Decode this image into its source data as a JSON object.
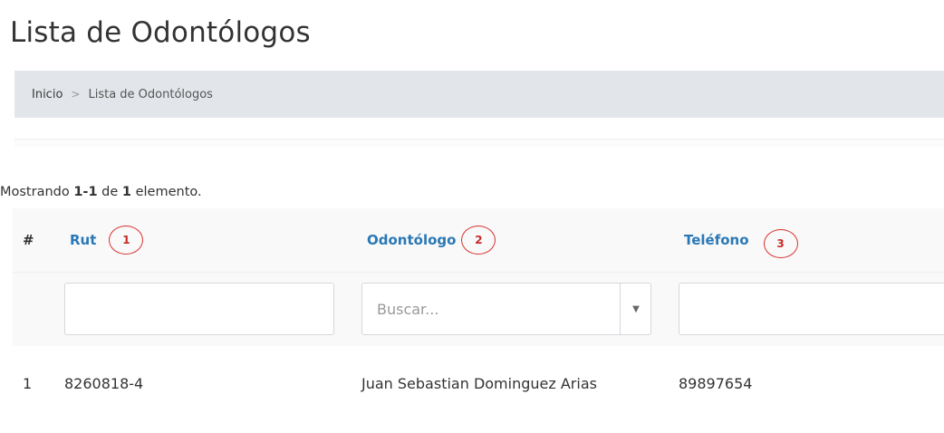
{
  "page": {
    "title": "Lista de Odontólogos"
  },
  "breadcrumb": {
    "home": "Inicio",
    "separator": ">",
    "current": "Lista de Odontólogos"
  },
  "summary": {
    "prefix": "Mostrando ",
    "range": "1-1",
    "middle": " de ",
    "total": "1",
    "suffix": " elemento."
  },
  "table": {
    "columns": [
      {
        "label": "#",
        "badge": ""
      },
      {
        "label": "Rut",
        "badge": "1"
      },
      {
        "label": "Odontólogo",
        "badge": "2"
      },
      {
        "label": "Teléfono",
        "badge": "3"
      }
    ],
    "filters": {
      "rut_value": "",
      "odontologo_placeholder": "Buscar...",
      "telefono_value": ""
    },
    "rows": [
      {
        "num": "1",
        "rut": "8260818-4",
        "odontologo": "Juan Sebastian Dominguez Arias",
        "telefono": "89897654"
      }
    ]
  },
  "icons": {
    "dropdown": "chevron-down-icon"
  },
  "colors": {
    "link": "#2a78b5",
    "badge": "#d8322e",
    "breadcrumb_bg": "#e2e5e9"
  }
}
